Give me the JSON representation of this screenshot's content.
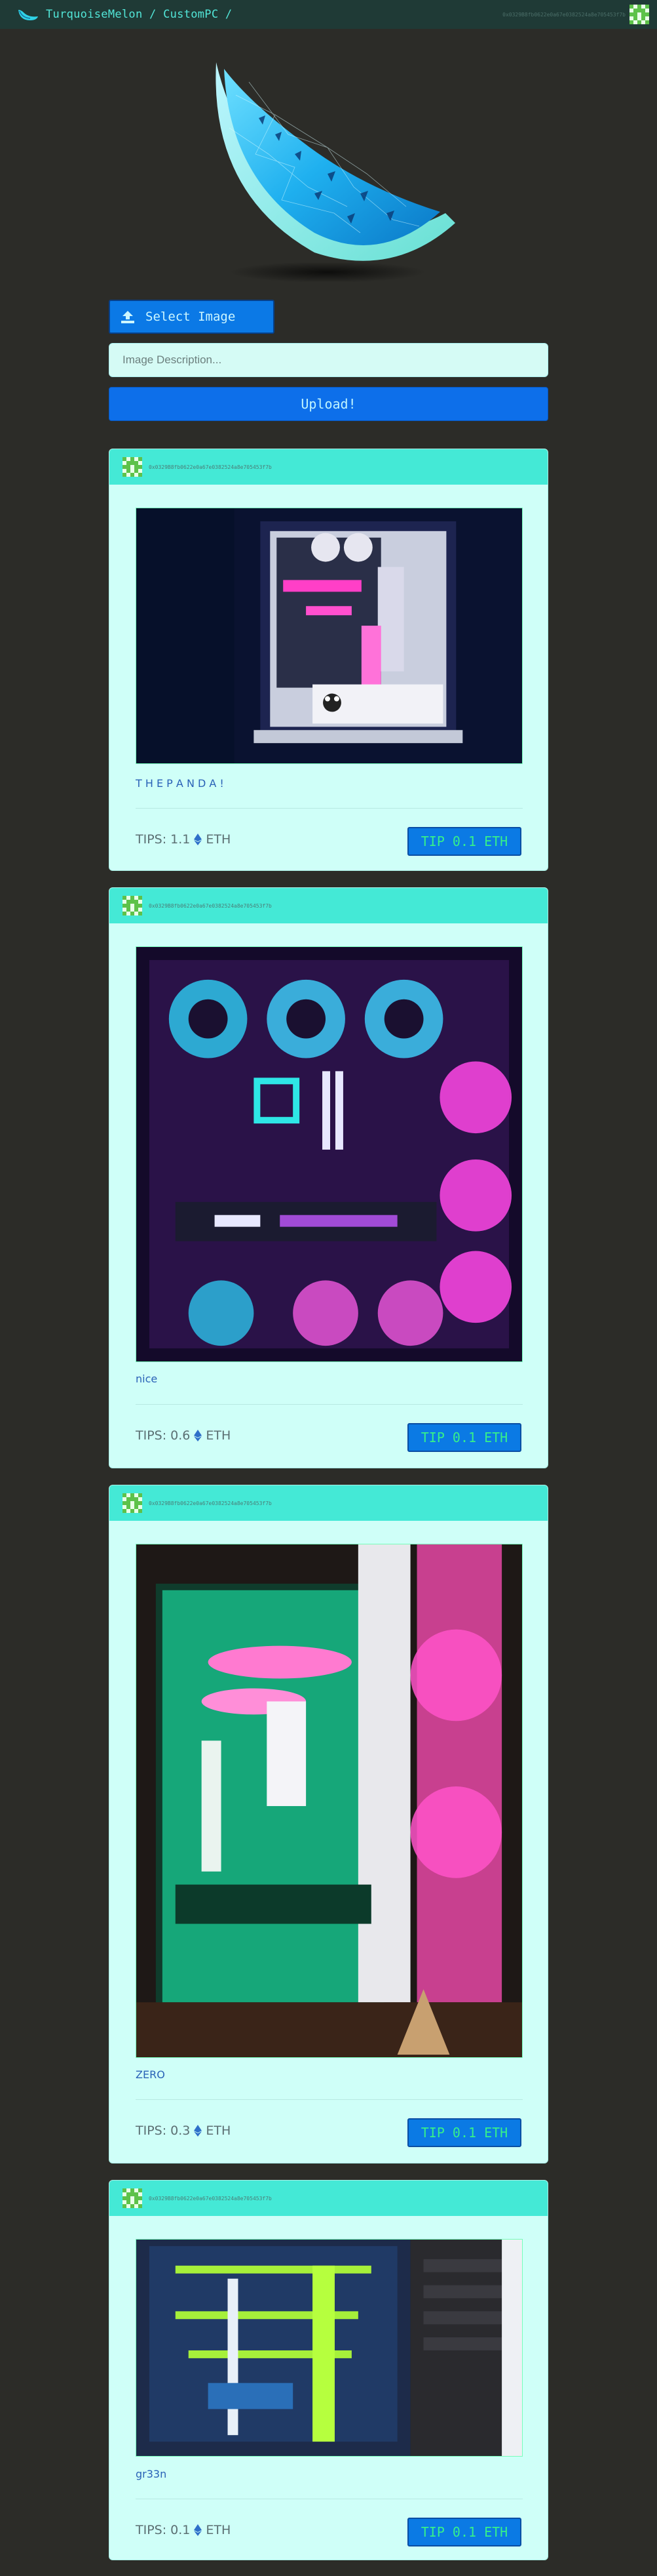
{
  "navbar": {
    "brand": "TurquoiseMelon / CustomPC /",
    "account": "0x0329B8fb0622e0a67e0382524a8e705453f7b"
  },
  "upload": {
    "select_label": "Select Image",
    "description_placeholder": "Image Description...",
    "upload_label": "Upload!"
  },
  "posts": [
    {
      "author": "0x0329B8fb0622e0a67e0382524a8e705453f7b",
      "description": "T H E P A N D A !",
      "tips_label": "TIPS: 1.1",
      "currency": "ETH",
      "tip_button": "TIP 0.1 ETH"
    },
    {
      "author": "0x0329B8fb0622e0a67e0382524a8e705453f7b",
      "description": "nice",
      "tips_label": "TIPS: 0.6",
      "currency": "ETH",
      "tip_button": "TIP 0.1 ETH"
    },
    {
      "author": "0x0329B8fb0622e0a67e0382524a8e705453f7b",
      "description": "ZERO",
      "tips_label": "TIPS: 0.3",
      "currency": "ETH",
      "tip_button": "TIP 0.1 ETH"
    },
    {
      "author": "0x0329B8fb0622e0a67e0382524a8e705453f7b",
      "description": "gr33n",
      "tips_label": "TIPS: 0.1",
      "currency": "ETH",
      "tip_button": "TIP 0.1 ETH"
    }
  ],
  "colors": {
    "background": "#2c2c28",
    "navbar": "#1f3a36",
    "accent_turquoise": "#44e9d6",
    "card_bg": "#cffff8",
    "button_blue": "#0b7ae4",
    "tip_text_green": "#36f08a"
  },
  "icons": {
    "brand": "melon-slice-icon",
    "select": "upload-arrow-icon",
    "currency": "ethereum-icon",
    "avatar": "identicon-avatar"
  }
}
